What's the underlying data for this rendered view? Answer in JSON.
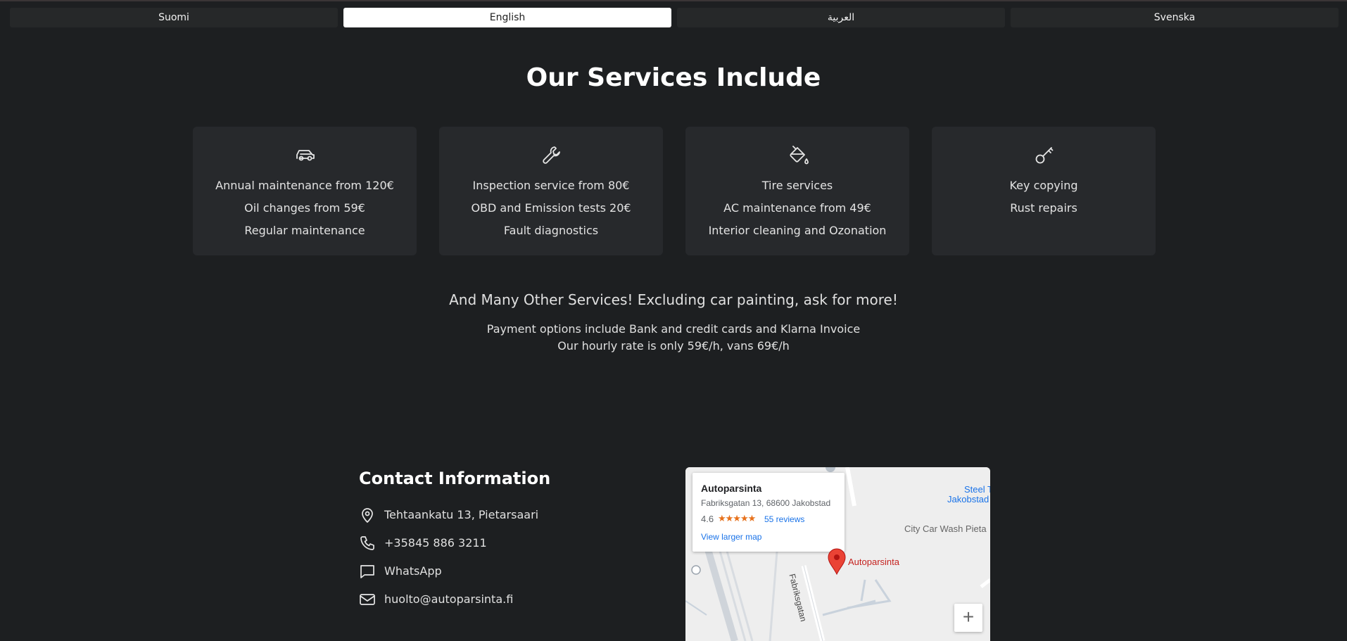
{
  "languages": [
    {
      "label": "Suomi",
      "active": false
    },
    {
      "label": "English",
      "active": true
    },
    {
      "label": "العربية",
      "active": false
    },
    {
      "label": "Svenska",
      "active": false
    }
  ],
  "services": {
    "title": "Our Services Include",
    "cards": [
      {
        "icon": "car-icon",
        "lines": [
          "Annual maintenance from 120€",
          "Oil changes from 59€",
          "Regular maintenance"
        ]
      },
      {
        "icon": "wrench-icon",
        "lines": [
          "Inspection service from 80€",
          "OBD and Emission tests 20€",
          "Fault diagnostics"
        ]
      },
      {
        "icon": "paint-bucket-icon",
        "lines": [
          "Tire services",
          "AC maintenance from 49€",
          "Interior cleaning and Ozonation"
        ]
      },
      {
        "icon": "key-icon",
        "lines": [
          "Key copying",
          "Rust repairs"
        ]
      }
    ],
    "many_other": "And Many Other Services! Excluding car painting, ask for more!",
    "payment": "Payment options include Bank and credit cards and Klarna Invoice",
    "hourly": "Our hourly rate is only 59€/h, vans 69€/h"
  },
  "contact": {
    "title": "Contact Information",
    "address": "Tehtaankatu 13, Pietarsaari",
    "phone": "+35845 886 3211",
    "whatsapp": "WhatsApp",
    "email": "huolto@autoparsinta.fi"
  },
  "map": {
    "place_name": "Autoparsinta",
    "place_address": "Fabriksgatan 13, 68600 Jakobstad",
    "rating": "4.6",
    "stars": "★★★★★",
    "reviews": "55 reviews",
    "view_larger": "View larger map",
    "pin_label": "Autoparsinta",
    "street_label": "Fabriksgatan",
    "poi_city_car_wash": "City Car Wash Pieta",
    "poi_steel_line1": "Steel T",
    "poi_steel_line2": "Jakobstad",
    "zoom_in": "+",
    "colors": {
      "pin": "#ea4335",
      "link": "#1a73e8",
      "stars": "#e7711b"
    }
  }
}
